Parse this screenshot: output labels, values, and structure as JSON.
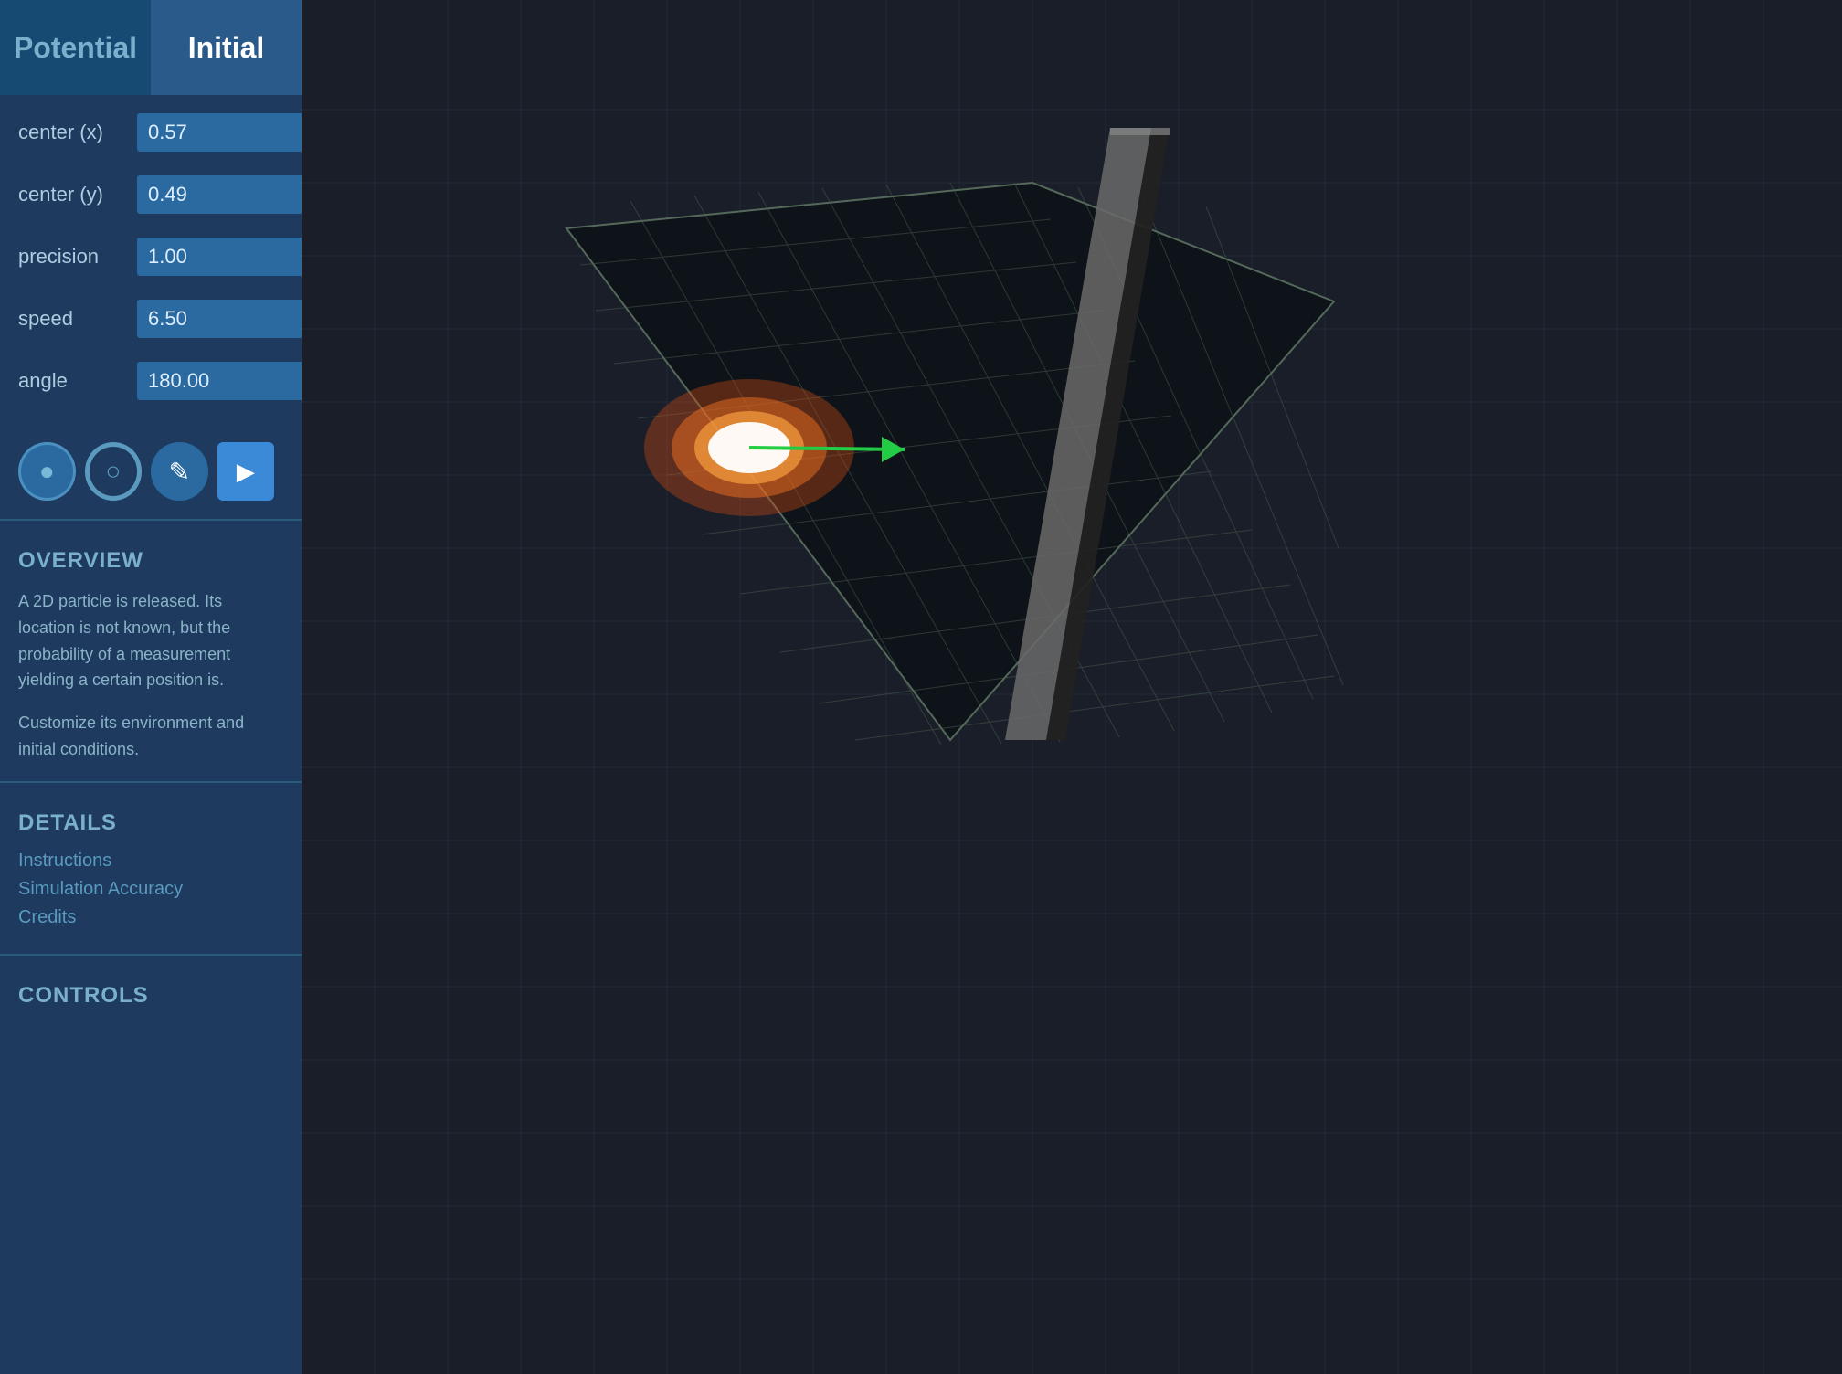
{
  "tabs": [
    {
      "id": "potential",
      "label": "Potential",
      "active": false
    },
    {
      "id": "initial",
      "label": "Initial",
      "active": true
    }
  ],
  "params": [
    {
      "id": "center_x",
      "label": "center (x)",
      "value": "0.57"
    },
    {
      "id": "center_y",
      "label": "center (y)",
      "value": "0.49"
    },
    {
      "id": "precision",
      "label": "precision",
      "value": "1.00"
    },
    {
      "id": "speed",
      "label": "speed",
      "value": "6.50"
    },
    {
      "id": "angle",
      "label": "angle",
      "value": "180.00"
    }
  ],
  "toolbar": {
    "circle_filled_label": "●",
    "circle_ring_label": "○",
    "pencil_label": "✎",
    "play_label": "▶"
  },
  "overview": {
    "title": "OVERVIEW",
    "text1": "A 2D particle is released.  Its location is not known, but the probability of a measurement yielding a certain position is.",
    "text2": "Customize its environment and initial conditions."
  },
  "details": {
    "title": "DETAILS",
    "links": [
      "Instructions",
      "Simulation Accuracy",
      "Credits"
    ]
  },
  "controls": {
    "title": "CONTROLS"
  },
  "colors": {
    "sidebar_bg": "#1e3a5f",
    "tab_active_bg": "#2a5a8a",
    "tab_inactive_bg": "#174a72",
    "param_input_bg": "#2a6aa0",
    "viewport_bg": "#1a1e28",
    "grid_line": "#2a3040",
    "plane_color": "#111620",
    "plane_border": "#6a8a7a",
    "wall_color": "#555",
    "wall_dark": "#222",
    "particle_outer": "#e06010",
    "particle_inner": "#ffffff",
    "arrow_color": "#22cc44"
  }
}
